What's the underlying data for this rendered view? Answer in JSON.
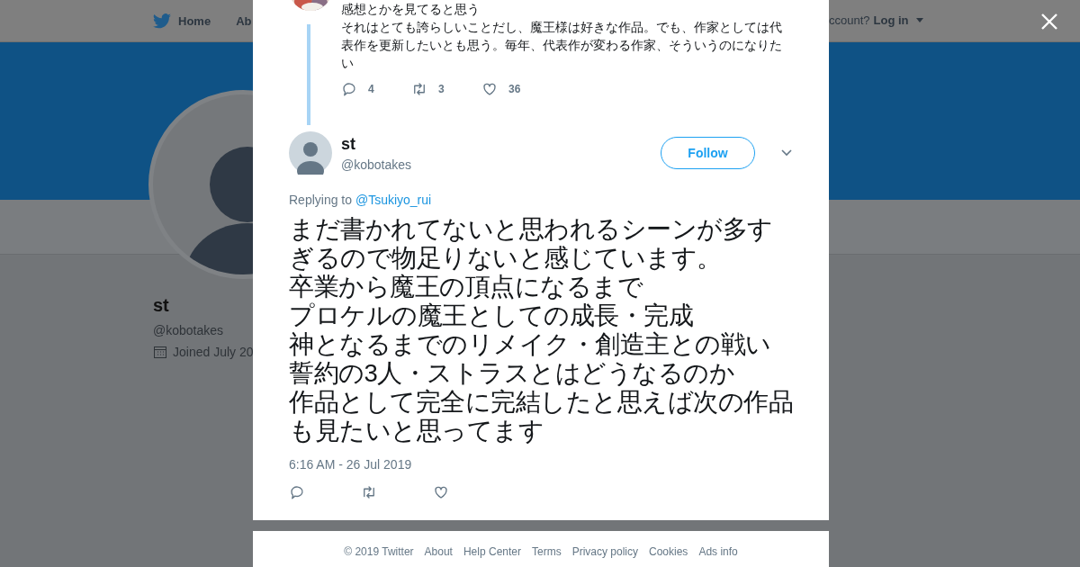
{
  "nav": {
    "home": "Home",
    "about": "Ab",
    "account_prompt": "ccount?",
    "login": "Log in"
  },
  "profile": {
    "name": "st",
    "handle": "@kobotakes",
    "joined": "Joined July 20"
  },
  "parent_tweet": {
    "lines": [
      "感想とかを見てると思う",
      "それはとても誇らしいことだし、魔王様は好きな作品。でも、作家としては代表作を更新したいとも思う。毎年、代表作が変わる作家、そういうのになりたい"
    ],
    "replies": "4",
    "retweets": "3",
    "likes": "36"
  },
  "tweet": {
    "name": "st",
    "handle": "@kobotakes",
    "follow": "Follow",
    "replying_label": "Replying to",
    "replying_to": "@Tsukiyo_rui",
    "text_lines": [
      "まだ書かれてないと思われるシーンが多す",
      "ぎるので物足りないと感じています。",
      "卒業から魔王の頂点になるまで",
      "プロケルの魔王としての成長・完成",
      "神となるまでのリメイク・創造主との戦い",
      "誓約の3人・ストラスとはどうなるのか",
      "作品として完全に完結したと思えば次の作品",
      "も見たいと思ってます"
    ],
    "time": "6:16 AM - 26 Jul 2019"
  },
  "footer": [
    "© 2019 Twitter",
    "About",
    "Help Center",
    "Terms",
    "Privacy policy",
    "Cookies",
    "Ads info"
  ]
}
